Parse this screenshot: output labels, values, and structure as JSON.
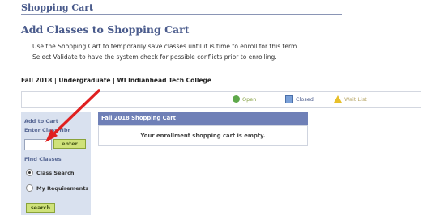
{
  "page": {
    "title": "Shopping Cart",
    "heading": "Add Classes to Shopping Cart",
    "instructions": [
      "Use the Shopping Cart to temporarily save classes until it is time to enroll for this term.",
      "Select Validate to have the system check for possible conflicts prior to enrolling."
    ],
    "term_line": "Fall 2018 | Undergraduate | WI Indianhead Tech College"
  },
  "legend": {
    "open": {
      "label": "Open",
      "icon": "green-circle-icon",
      "color": "#5ea84a"
    },
    "closed": {
      "label": "Closed",
      "icon": "blue-square-icon",
      "color": "#7aa0d8"
    },
    "wait": {
      "label": "Wait List",
      "icon": "yellow-triangle-icon",
      "color": "#e8c02a"
    }
  },
  "left_panel": {
    "add_to_cart": "Add to Cart",
    "enter_class_label": "Enter Class Nbr",
    "class_nbr_value": "",
    "enter_button": "enter",
    "find_classes": "Find Classes",
    "options": [
      {
        "label": "Class Search",
        "checked": true
      },
      {
        "label": "My Requirements",
        "checked": false
      }
    ],
    "search_button": "search"
  },
  "cart": {
    "header": "Fall 2018 Shopping Cart",
    "empty_message": "Your enrollment shopping cart is empty."
  },
  "annotation": {
    "arrow_color": "#e02020"
  }
}
